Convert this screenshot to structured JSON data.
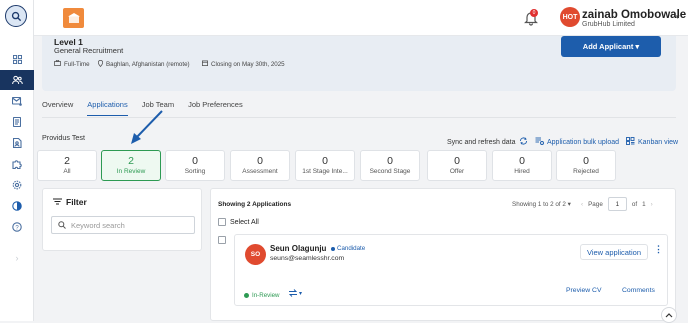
{
  "header": {
    "user_name": "zainab Omobowale",
    "user_org": "GrubHub Limited",
    "avatar_text": "HOT",
    "notification_count": "0",
    "colors": {
      "brand": "#18345f",
      "accent": "#1d5dac",
      "success": "#2d9a53",
      "avatar": "#e04a2f"
    }
  },
  "job": {
    "level": "Level 1",
    "category": "General Recruitment",
    "type": "Full-Time",
    "location": "Baghlan, Afghanistan (remote)",
    "closing": "Closing on May 30th, 2025",
    "add_button": "Add Applicant ▾"
  },
  "tabs": [
    "Overview",
    "Applications",
    "Job Team",
    "Job Preferences"
  ],
  "active_tab": "Applications",
  "section_title": "Providus Test",
  "actions": {
    "sync": "Sync and refresh data",
    "bulk_upload": "Application bulk upload",
    "kanban": "Kanban view"
  },
  "stages": [
    {
      "count": "2",
      "label": "All"
    },
    {
      "count": "2",
      "label": "In Review",
      "active": true
    },
    {
      "count": "0",
      "label": "Sorting"
    },
    {
      "count": "0",
      "label": "Assessment"
    },
    {
      "count": "0",
      "label": "1st Stage Inte..."
    },
    {
      "count": "0",
      "label": "Second Stage"
    },
    {
      "count": "0",
      "label": "Offer"
    },
    {
      "count": "0",
      "label": "Hired"
    },
    {
      "count": "0",
      "label": "Rejected"
    }
  ],
  "filter": {
    "title": "Filter",
    "search_placeholder": "Keyword search"
  },
  "applications": {
    "heading": "Showing 2 Applications",
    "range_text": "Showing 1 to 2 of 2 ▾",
    "page_label": "Page",
    "page_value": "1",
    "of_label": "of",
    "total_pages": "1",
    "select_all": "Select All",
    "items": [
      {
        "initials": "SO",
        "name": "Seun Olagunju",
        "tag": "Candidate",
        "email": "seuns@seamlesshr.com",
        "status": "In-Review",
        "view_button": "View application",
        "preview_cv": "Preview CV",
        "comments": "Comments"
      }
    ]
  },
  "icons": [
    "search-icon",
    "grid-icon",
    "users-icon",
    "mail-icon",
    "document-icon",
    "file-user-icon",
    "puzzle-icon",
    "gear-icon",
    "compass-icon",
    "help-icon",
    "bell-icon",
    "filter-icon",
    "sync-icon",
    "upload-icon",
    "kanban-icon",
    "chevron-up-icon"
  ]
}
